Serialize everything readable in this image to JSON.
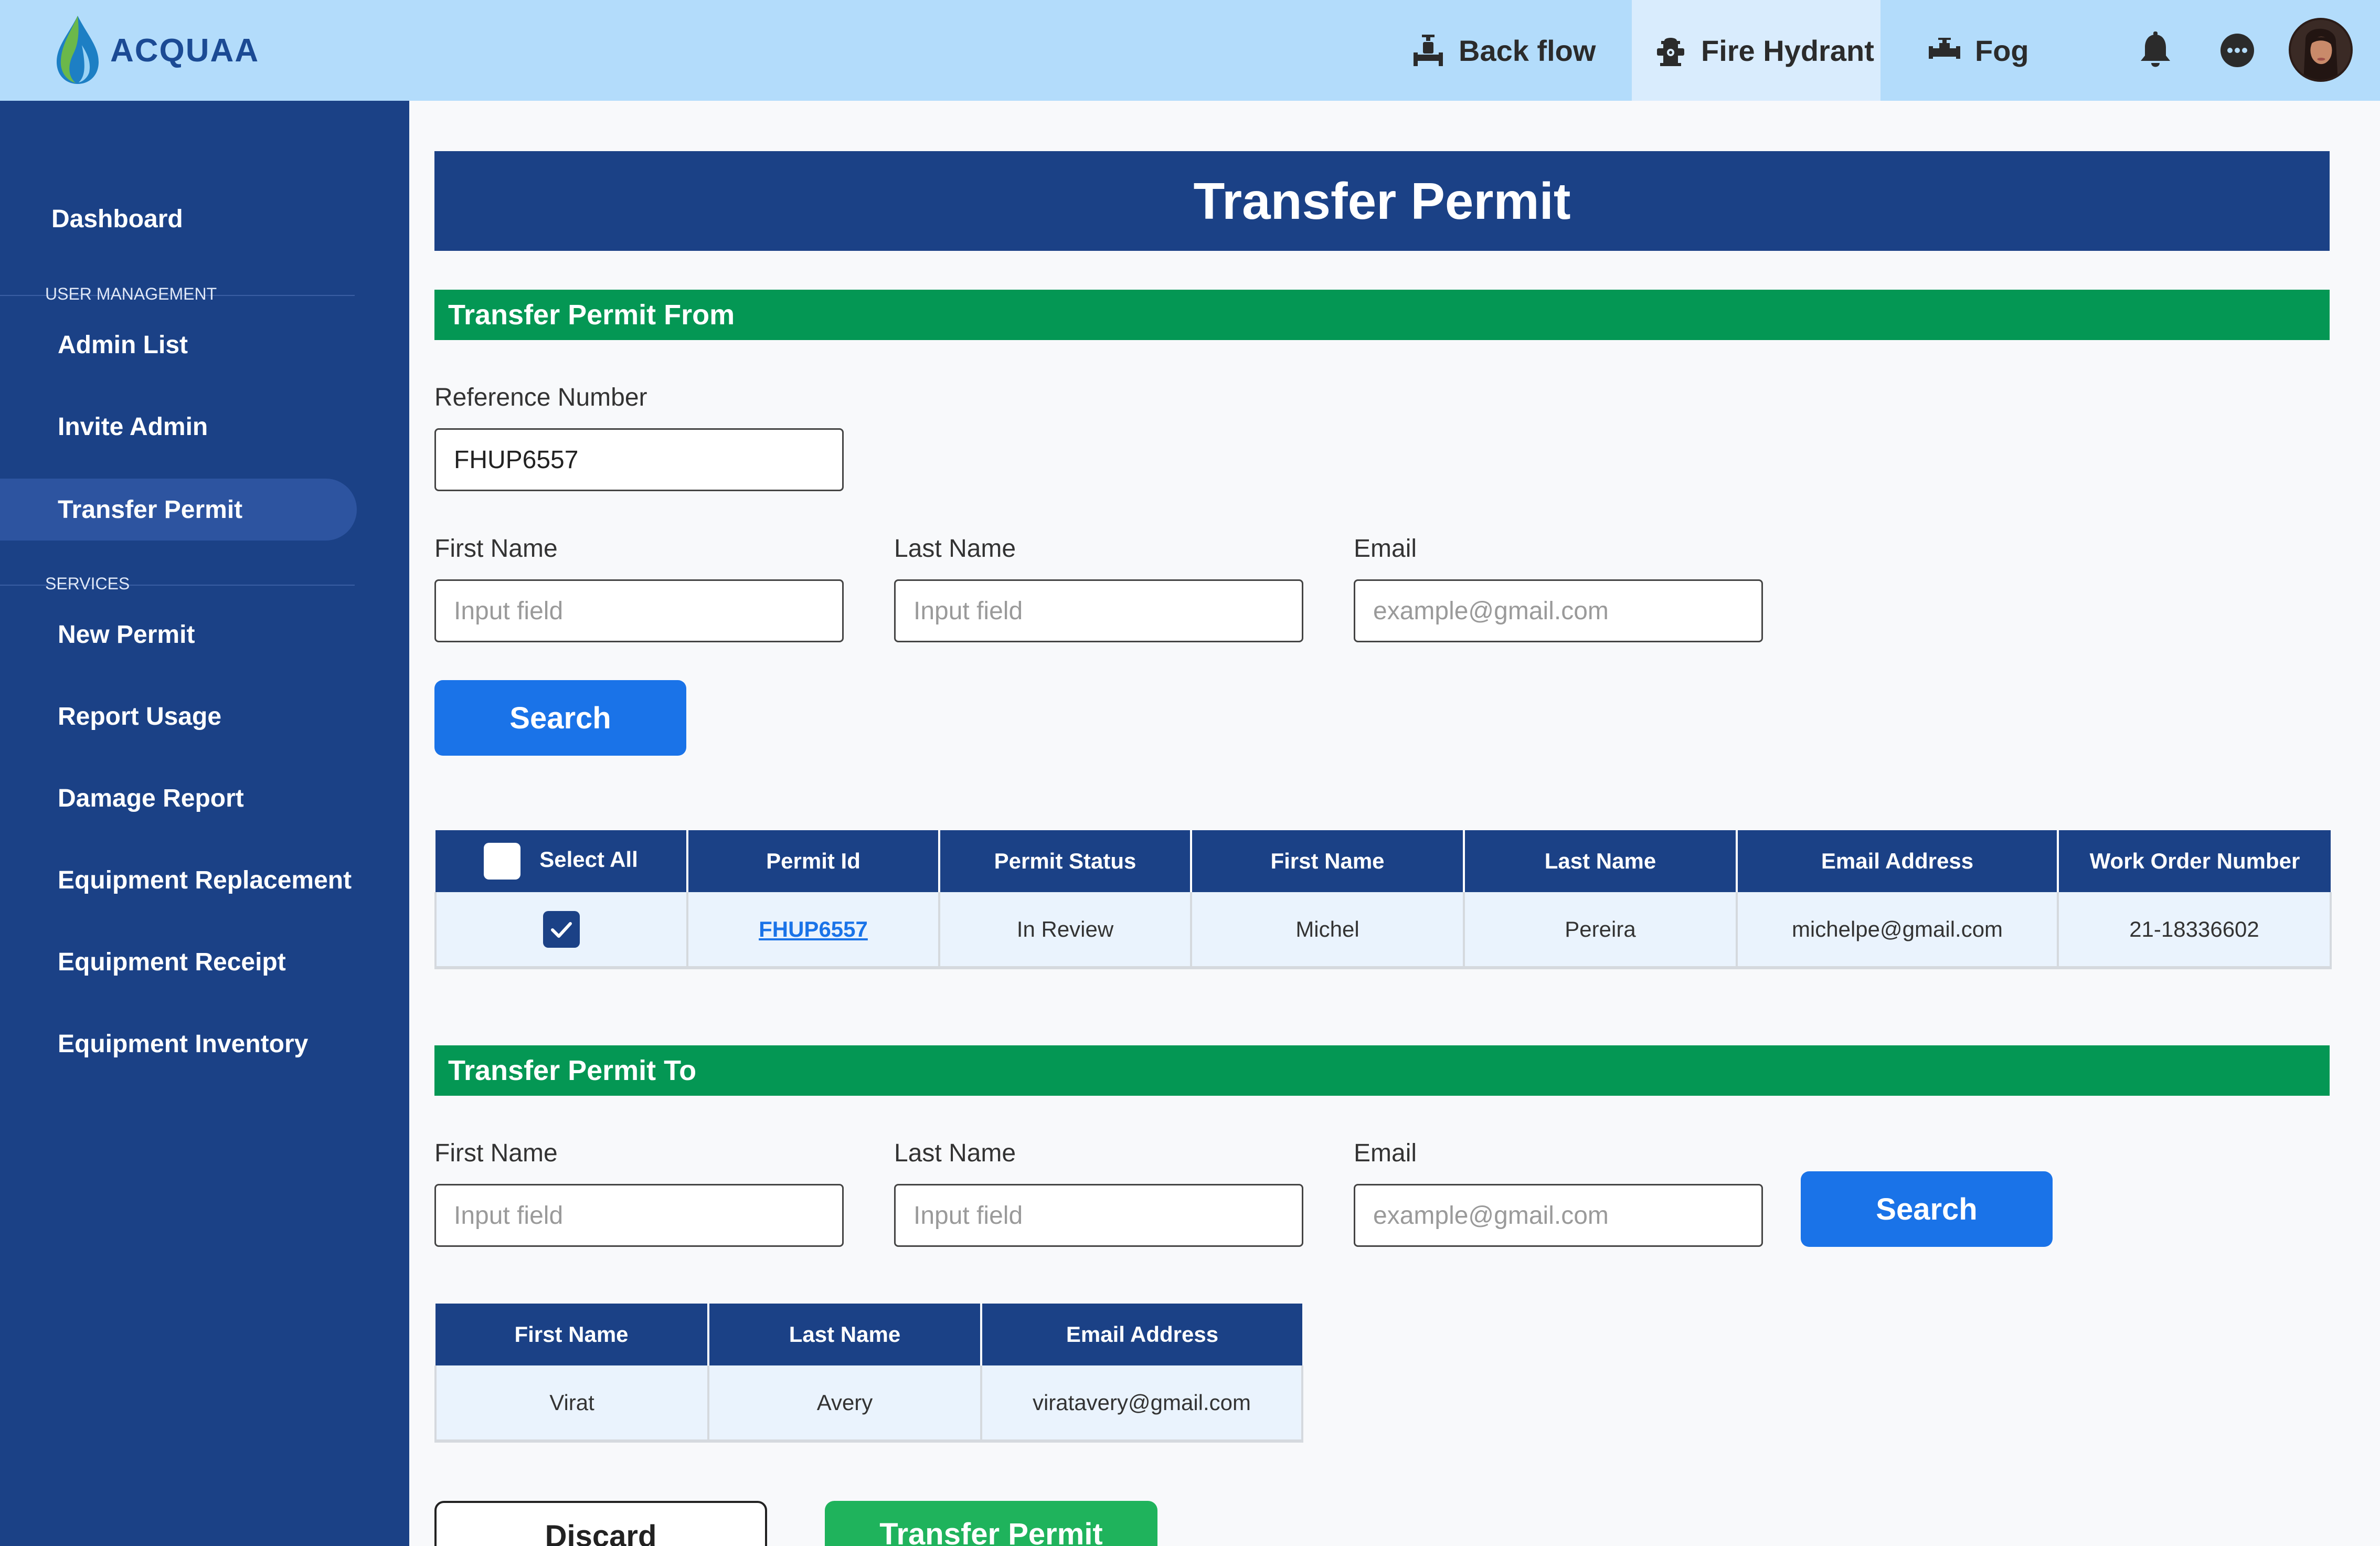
{
  "app": {
    "brand": "ACQUAA"
  },
  "nav": {
    "tabs": [
      {
        "label": "Back flow",
        "icon": "backflow-valve-icon"
      },
      {
        "label": "Fire Hydrant",
        "icon": "fire-hydrant-icon",
        "active": true
      },
      {
        "label": "Fog",
        "icon": "fog-pipe-icon"
      }
    ],
    "icons": [
      "bell-icon",
      "chat-icon",
      "avatar"
    ]
  },
  "sidebar": {
    "dashboard": "Dashboard",
    "section_user": "USER MANAGEMENT",
    "user_items": [
      "Admin List",
      "Invite Admin",
      "Transfer Permit"
    ],
    "active_item": "Transfer Permit",
    "section_services": "SERVICES",
    "service_items": [
      "New Permit",
      "Report Usage",
      "Damage Report",
      "Equipment Replacement",
      "Equipment Receipt",
      "Equipment Inventory"
    ]
  },
  "page": {
    "title": "Transfer Permit",
    "from": {
      "section_title": "Transfer Permit From",
      "reference_label": "Reference Number",
      "reference_value": "FHUP6557",
      "first_name_label": "First Name",
      "first_name_placeholder": "Input field",
      "last_name_label": "Last Name",
      "last_name_placeholder": "Input field",
      "email_label": "Email",
      "email_placeholder": "example@gmail.com",
      "search_label": "Search",
      "table": {
        "select_all": "Select All",
        "headers": [
          "Permit Id",
          "Permit Status",
          "First Name",
          "Last Name",
          "Email Address",
          "Work Order Number"
        ],
        "rows": [
          {
            "checked": true,
            "permit_id": "FHUP6557",
            "status": "In Review",
            "first": "Michel",
            "last": "Pereira",
            "email": "michelpe@gmail.com",
            "work_order": "21-18336602"
          }
        ]
      }
    },
    "to": {
      "section_title": "Transfer Permit To",
      "first_name_label": "First Name",
      "first_name_placeholder": "Input field",
      "last_name_label": "Last Name",
      "last_name_placeholder": "Input field",
      "email_label": "Email",
      "email_placeholder": "example@gmail.com",
      "search_label": "Search",
      "table": {
        "headers": [
          "First Name",
          "Last Name",
          "Email Address"
        ],
        "rows": [
          {
            "first": "Virat",
            "last": "Avery",
            "email": "viratavery@gmail.com"
          }
        ]
      }
    },
    "actions": {
      "discard": "Discard",
      "transfer": "Transfer Permit"
    }
  },
  "colors": {
    "primary": "#1b4186",
    "accent_blue": "#1a73e8",
    "green": "#049754",
    "topbar": "#b3dcfb"
  }
}
